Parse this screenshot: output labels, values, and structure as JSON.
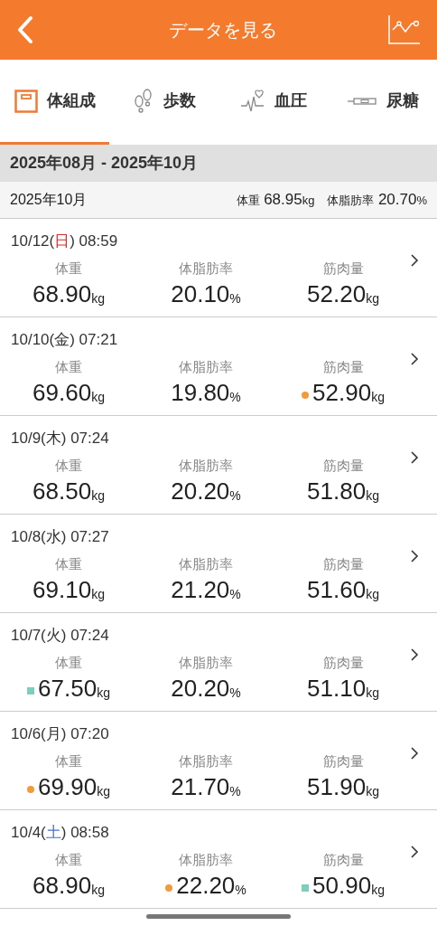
{
  "header": {
    "title": "データを見る"
  },
  "tabs": [
    {
      "label": "体組成",
      "kind": "scale",
      "selected": true
    },
    {
      "label": "歩数",
      "kind": "steps",
      "selected": false
    },
    {
      "label": "血圧",
      "kind": "heart",
      "selected": false
    },
    {
      "label": "尿糖",
      "kind": "strip",
      "selected": false
    }
  ],
  "range": "2025年08月 - 2025年10月",
  "month": {
    "label": "2025年10月",
    "stats": [
      {
        "label": "体重",
        "value": "68.95",
        "unit": "kg"
      },
      {
        "label": "体脂肪率",
        "value": "20.70",
        "unit": "%"
      }
    ]
  },
  "records": [
    {
      "date": "10/12(",
      "weekday": {
        "text": "日",
        "color": "#d0312d"
      },
      "time": ") 08:59",
      "values": [
        {
          "label": "体重",
          "value": "68.90",
          "unit": "kg"
        },
        {
          "label": "体脂肪率",
          "value": "20.10",
          "unit": "%"
        },
        {
          "label": "筋肉量",
          "value": "52.20",
          "unit": "kg"
        }
      ]
    },
    {
      "date": "10/10(",
      "weekday": {
        "text": "金",
        "color": "#333333"
      },
      "time": ") 07:21",
      "values": [
        {
          "label": "体重",
          "value": "69.60",
          "unit": "kg"
        },
        {
          "label": "体脂肪率",
          "value": "19.80",
          "unit": "%"
        },
        {
          "label": "筋肉量",
          "value": "52.90",
          "unit": "kg",
          "marker": {
            "kind": "circle",
            "color": "#f39a3c"
          }
        }
      ]
    },
    {
      "date": "10/9(",
      "weekday": {
        "text": "木",
        "color": "#333333"
      },
      "time": ") 07:24",
      "values": [
        {
          "label": "体重",
          "value": "68.50",
          "unit": "kg"
        },
        {
          "label": "体脂肪率",
          "value": "20.20",
          "unit": "%"
        },
        {
          "label": "筋肉量",
          "value": "51.80",
          "unit": "kg"
        }
      ]
    },
    {
      "date": "10/8(",
      "weekday": {
        "text": "水",
        "color": "#333333"
      },
      "time": ") 07:27",
      "values": [
        {
          "label": "体重",
          "value": "69.10",
          "unit": "kg"
        },
        {
          "label": "体脂肪率",
          "value": "21.20",
          "unit": "%"
        },
        {
          "label": "筋肉量",
          "value": "51.60",
          "unit": "kg"
        }
      ]
    },
    {
      "date": "10/7(",
      "weekday": {
        "text": "火",
        "color": "#333333"
      },
      "time": ") 07:24",
      "values": [
        {
          "label": "体重",
          "value": "67.50",
          "unit": "kg",
          "marker": {
            "kind": "square",
            "color": "#7ccfbd"
          }
        },
        {
          "label": "体脂肪率",
          "value": "20.20",
          "unit": "%"
        },
        {
          "label": "筋肉量",
          "value": "51.10",
          "unit": "kg"
        }
      ]
    },
    {
      "date": "10/6(",
      "weekday": {
        "text": "月",
        "color": "#333333"
      },
      "time": ") 07:20",
      "values": [
        {
          "label": "体重",
          "value": "69.90",
          "unit": "kg",
          "marker": {
            "kind": "circle",
            "color": "#f39a3c"
          }
        },
        {
          "label": "体脂肪率",
          "value": "21.70",
          "unit": "%"
        },
        {
          "label": "筋肉量",
          "value": "51.90",
          "unit": "kg"
        }
      ]
    },
    {
      "date": "10/4(",
      "weekday": {
        "text": "土",
        "color": "#4a72c4"
      },
      "time": ") 08:58",
      "values": [
        {
          "label": "体重",
          "value": "68.90",
          "unit": "kg"
        },
        {
          "label": "体脂肪率",
          "value": "22.20",
          "unit": "%",
          "marker": {
            "kind": "circle",
            "color": "#f39a3c"
          }
        },
        {
          "label": "筋肉量",
          "value": "50.90",
          "unit": "kg",
          "marker": {
            "kind": "square",
            "color": "#7ccfbd"
          }
        }
      ]
    }
  ]
}
